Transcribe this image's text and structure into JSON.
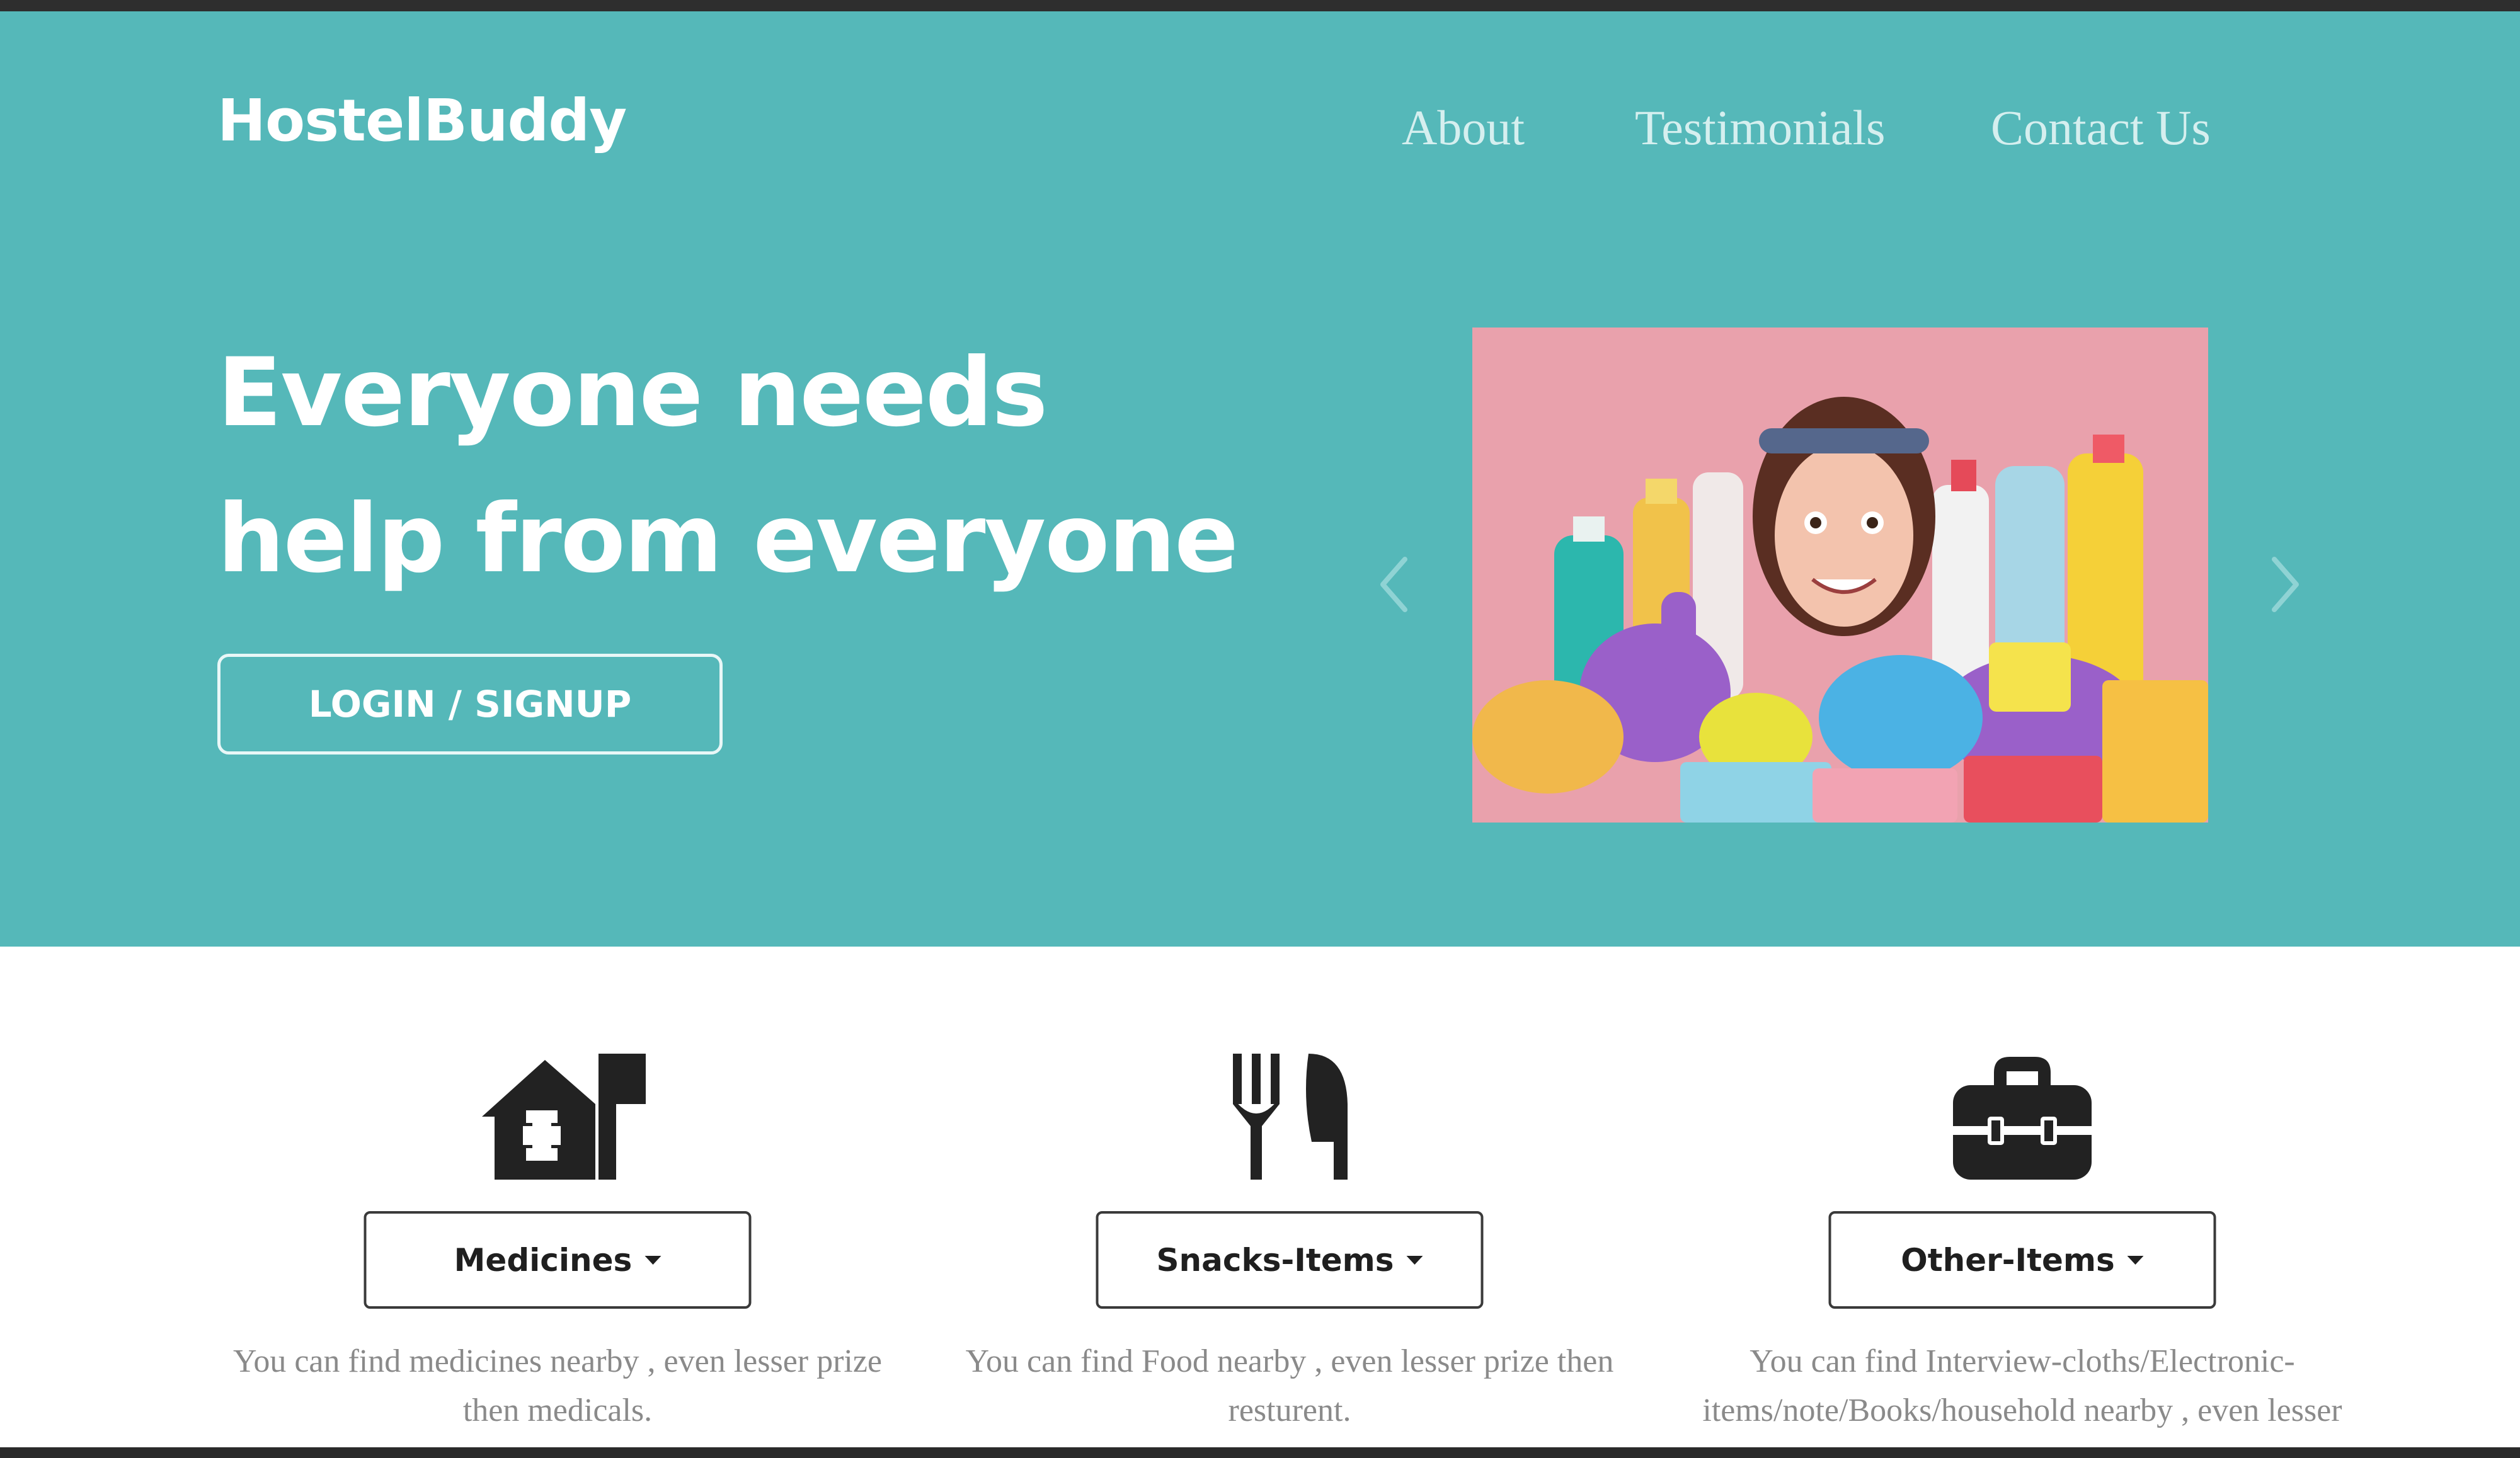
{
  "header": {
    "brand": "HostelBuddy",
    "nav": [
      {
        "label": "About"
      },
      {
        "label": "Testimonials"
      },
      {
        "label": "Contact Us"
      }
    ]
  },
  "hero": {
    "headline_line1": "Everyone needs",
    "headline_line2": "help from everyone",
    "cta_label": "LOGIN / SIGNUP",
    "carousel": {
      "prev_icon": "chevron-left-icon",
      "next_icon": "chevron-right-icon"
    }
  },
  "features": [
    {
      "icon": "home-medical-icon",
      "label": "Medicines",
      "description": "You can find medicines nearby , even lesser prize then medicals."
    },
    {
      "icon": "fork-knife-icon",
      "label": "Snacks-Items",
      "description": "You can find Food nearby , even lesser prize then resturent."
    },
    {
      "icon": "toolbox-icon",
      "label": "Other-Items",
      "description": "You can find Interview-cloths/Electronic-items/note/Books/household nearby , even lesser"
    }
  ],
  "colors": {
    "hero_bg": "#55b8b9",
    "slide_bg": "#e9a1ac",
    "text_white": "#ffffff",
    "muted_text": "#8a8a8a"
  }
}
